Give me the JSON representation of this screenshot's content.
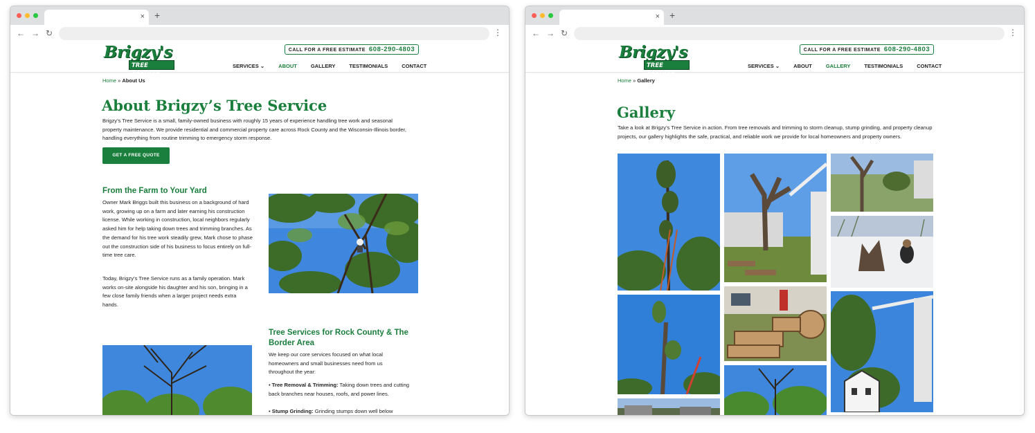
{
  "left": {
    "tab": {
      "close": "×",
      "new": "+"
    },
    "nav_icons": {
      "back": "←",
      "forward": "→",
      "reload": "↻",
      "menu": "⋮"
    },
    "brand": {
      "name": "Brigzy's",
      "sub": "TREE SERVICE"
    },
    "estimate": {
      "label": "CALL FOR A FREE ESTIMATE",
      "phone": "608-290-4803"
    },
    "menu": [
      "SERVICES ⌄",
      "ABOUT",
      "GALLERY",
      "TESTIMONIALS",
      "CONTACT"
    ],
    "active": "ABOUT",
    "crumb": {
      "home": "Home",
      "sep": " » ",
      "current": "About Us"
    },
    "title": "About Brigzy’s Tree Service",
    "intro": "Brigzy’s Tree Service is a small, family-owned business with roughly 15 years of experience handling tree work and seasonal property maintenance. We provide residential and commercial property care across Rock County and the Wisconsin-Illinois border, handling everything from routine trimming to emergency storm response.",
    "quote_button": "GET A FREE QUOTE",
    "farm_heading": "From the Farm to Your Yard",
    "farm_p1": "Owner Mark Briggs built this business on a background of hard work, growing up on a farm and later earning his construction license. While working in construction, local neighbors regularly asked him for help taking down trees and trimming branches. As the demand for his tree work steadily grew, Mark chose to phase out the construction side of his business to focus entirely on full-time tree care.",
    "farm_p2": "Today, Brigzy’s Tree Service runs as a family operation. Mark works on-site alongside his daughter and his son, bringing in a few close family friends when a larger project needs extra hands.",
    "services_heading": "Tree Services for Rock County & The Border Area",
    "services_p": "We keep our core services focused on what local homeowners and small businesses need from us throughout the year:",
    "services_list": [
      {
        "bold": "Tree Removal & Trimming:",
        "text": " Taking down trees and cutting back branches near houses, roofs, and power lines."
      },
      {
        "bold": "Stump Grinding:",
        "text": " Grinding stumps down well below"
      }
    ]
  },
  "right": {
    "crumb": {
      "home": "Home",
      "sep": " » ",
      "current": "Gallery"
    },
    "active": "GALLERY",
    "title": "Gallery",
    "intro": "Take a look at Brigzy’s Tree Service in action. From tree removals and trimming to storm cleanup, stump grinding, and property cleanup projects, our gallery highlights the safe, practical, and reliable work we provide for local homeowners and property owners."
  },
  "colors": {
    "brand_green": "#1a7f3c",
    "sky_blue": "#4a8bd8"
  }
}
